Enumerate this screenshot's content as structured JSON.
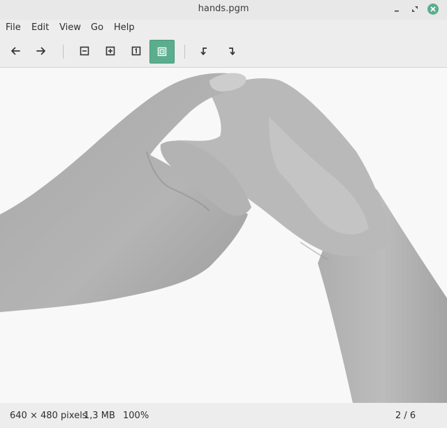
{
  "window": {
    "title": "hands.pgm"
  },
  "menu": {
    "items": [
      "File",
      "Edit",
      "View",
      "Go",
      "Help"
    ]
  },
  "toolbar": {
    "buttons": [
      {
        "name": "back-button",
        "icon": "arrow-left-icon"
      },
      {
        "name": "forward-button",
        "icon": "arrow-right-icon"
      },
      {
        "name": "zoom-out-button",
        "icon": "zoom-out-icon"
      },
      {
        "name": "zoom-in-button",
        "icon": "zoom-in-icon"
      },
      {
        "name": "zoom-normal-button",
        "icon": "zoom-original-icon"
      },
      {
        "name": "zoom-fit-button",
        "icon": "zoom-fit-icon",
        "active": true
      },
      {
        "name": "rotate-left-button",
        "icon": "rotate-left-icon"
      },
      {
        "name": "rotate-right-button",
        "icon": "rotate-right-icon"
      }
    ],
    "accent_color": "#5aae8e"
  },
  "image": {
    "description_icon": "grayscale-photo-hands"
  },
  "status": {
    "dimensions": "640 × 480 pixels",
    "size": "1,3 MB",
    "zoom": "100%",
    "position": "2 / 6"
  }
}
